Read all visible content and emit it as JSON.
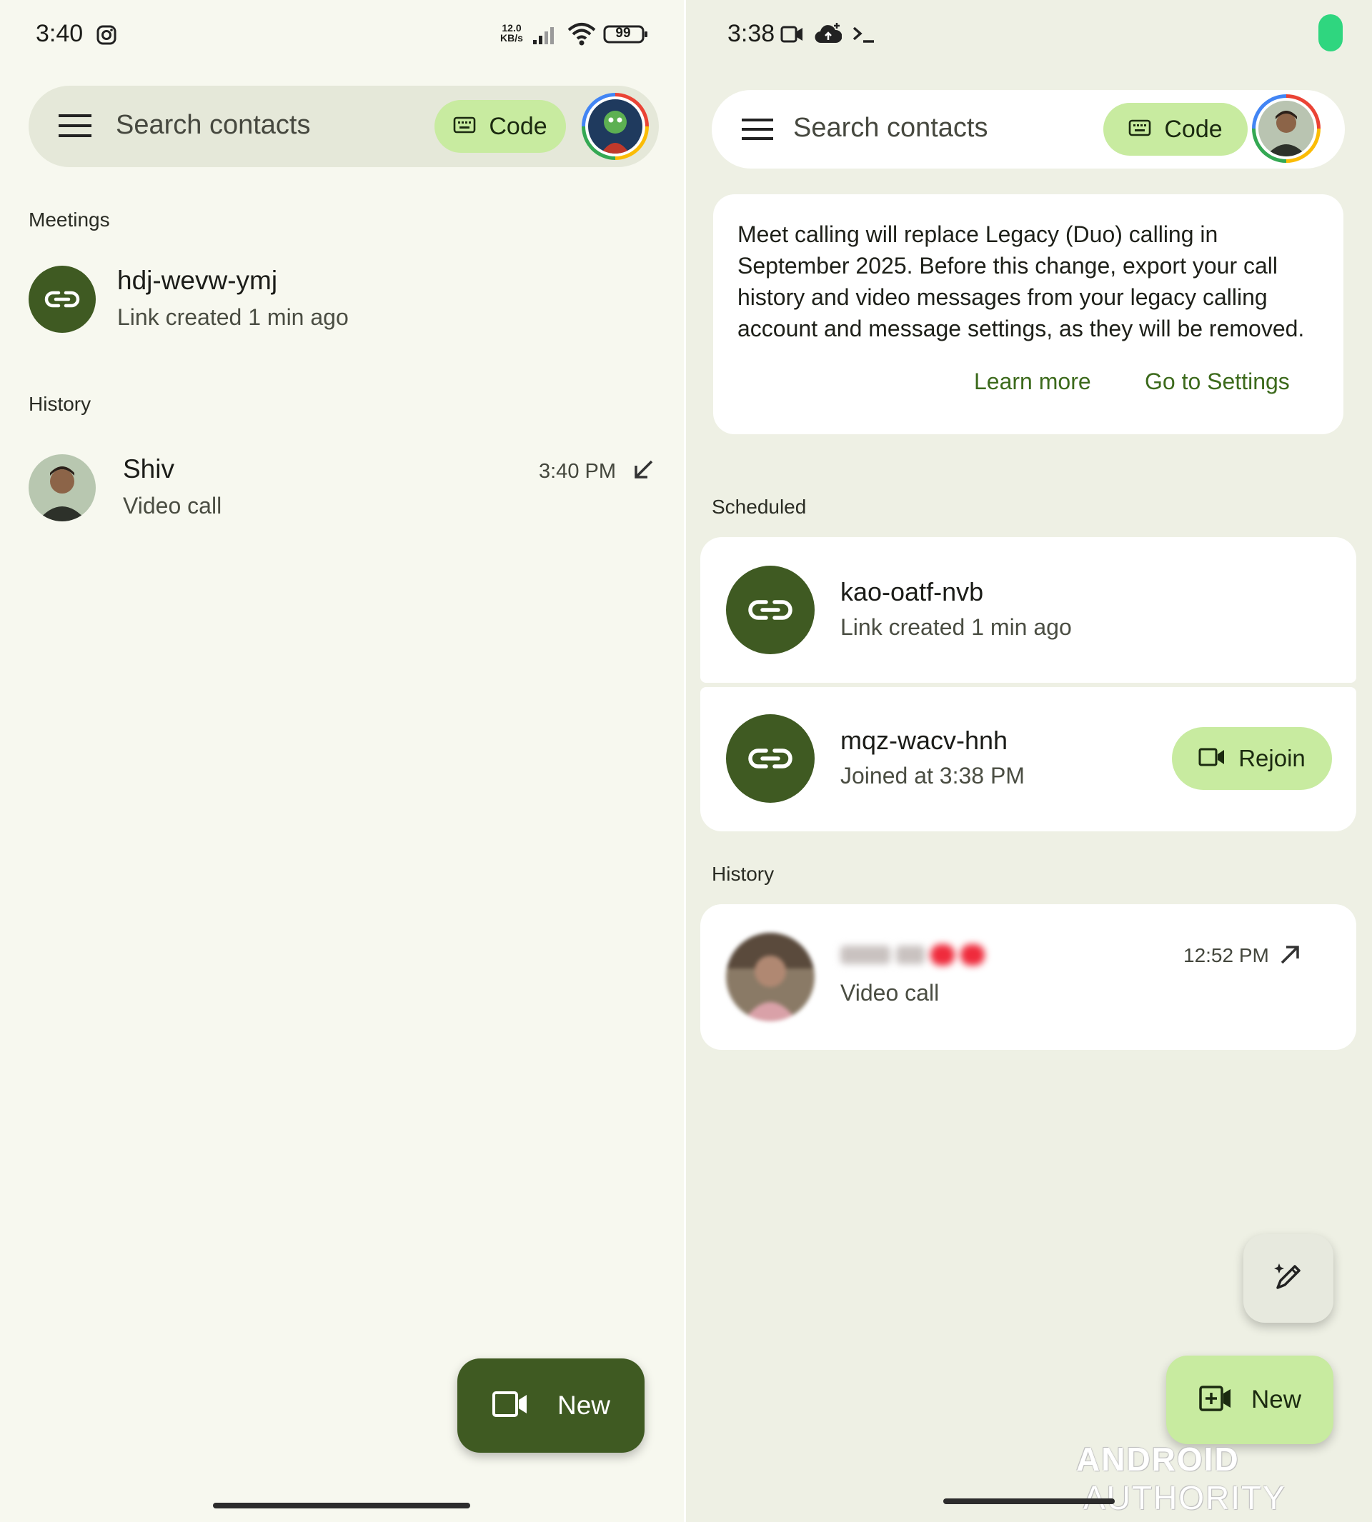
{
  "left": {
    "status": {
      "time": "3:40",
      "speed_value": "12.0",
      "speed_unit": "KB/s",
      "battery": "99"
    },
    "search": {
      "placeholder": "Search contacts",
      "code_label": "Code"
    },
    "meetings": {
      "title": "Meetings",
      "items": [
        {
          "code": "hdj-wevw-ymj",
          "subtitle": "Link created 1 min ago"
        }
      ]
    },
    "history": {
      "title": "History",
      "items": [
        {
          "name": "Shiv",
          "subtitle": "Video call",
          "time": "3:40 PM",
          "direction": "incoming"
        }
      ]
    },
    "fab": {
      "label": "New"
    }
  },
  "right": {
    "status": {
      "time": "3:38"
    },
    "search": {
      "placeholder": "Search contacts",
      "code_label": "Code"
    },
    "notice": {
      "lines": [
        "Meet calling will replace Legacy (Duo) calling in",
        "September 2025. Before this change, export your call",
        "history and video messages from your legacy calling",
        "account and message settings, as they will be removed."
      ],
      "learn_more": "Learn more",
      "go_to_settings": "Go to Settings"
    },
    "scheduled": {
      "title": "Scheduled",
      "items": [
        {
          "code": "kao-oatf-nvb",
          "subtitle": "Link created 1 min ago"
        },
        {
          "code": "mqz-wacv-hnh",
          "subtitle": "Joined at 3:38 PM",
          "action": "Rejoin"
        }
      ]
    },
    "history": {
      "title": "History",
      "items": [
        {
          "subtitle": "Video call",
          "time": "12:52 PM",
          "direction": "outgoing"
        }
      ]
    },
    "fab": {
      "label": "New"
    },
    "watermark": {
      "word1": "ANDROID",
      "word2": "AUTHORITY"
    }
  },
  "colors": {
    "left_bg": "#f7f8ef",
    "right_bg": "#eef0e4",
    "accent_dark": "#3f5a22",
    "accent_light": "#c8eba0",
    "status_dot": "#2fd67f"
  },
  "icons": [
    "instagram-icon",
    "signal-icon",
    "wifi-icon",
    "battery-icon",
    "video-status-icon",
    "cloud-upload-icon",
    "terminal-icon",
    "menu-icon",
    "keyboard-icon",
    "link-icon",
    "call-received-icon",
    "call-made-icon",
    "video-camera-icon",
    "video-add-icon",
    "edit-sparkle-icon"
  ]
}
